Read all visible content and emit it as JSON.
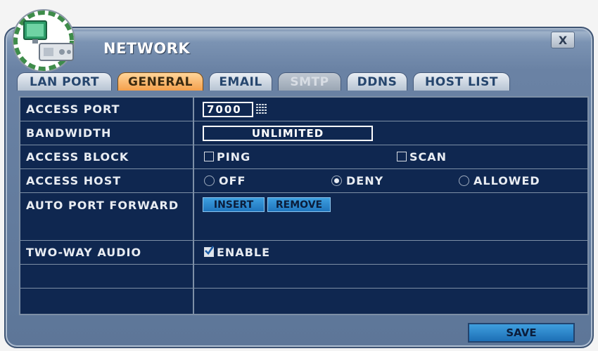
{
  "window": {
    "title": "NETWORK",
    "close_label": "X"
  },
  "tabs": [
    {
      "label": "LAN PORT",
      "state": "normal"
    },
    {
      "label": "GENERAL",
      "state": "active"
    },
    {
      "label": "EMAIL",
      "state": "normal"
    },
    {
      "label": "SMTP",
      "state": "disabled"
    },
    {
      "label": "DDNS",
      "state": "normal"
    },
    {
      "label": "HOST LIST",
      "state": "normal"
    }
  ],
  "rows": {
    "access_port": {
      "label": "ACCESS PORT",
      "value": "7000",
      "icon": "keypad-icon"
    },
    "bandwidth": {
      "label": "BANDWIDTH",
      "value": "UNLIMITED"
    },
    "access_block": {
      "label": "ACCESS BLOCK",
      "options": [
        {
          "label": "PING",
          "checked": false
        },
        {
          "label": "SCAN",
          "checked": false
        }
      ]
    },
    "access_host": {
      "label": "ACCESS HOST",
      "options": [
        {
          "label": "OFF",
          "selected": false
        },
        {
          "label": "DENY",
          "selected": true
        },
        {
          "label": "ALLOWED",
          "selected": false
        }
      ]
    },
    "auto_port_forward": {
      "label": "AUTO PORT FORWARD",
      "insert_label": "INSERT",
      "remove_label": "REMOVE"
    },
    "two_way_audio": {
      "label": "TWO-WAY AUDIO",
      "option": {
        "label": "ENABLE",
        "checked": true
      }
    }
  },
  "footer": {
    "save_label": "SAVE"
  },
  "colors": {
    "panel_bg": "#0f2750",
    "active_tab": "#f4a04c",
    "button_blue": "#1f75bd",
    "frame": "#6a82a4"
  }
}
